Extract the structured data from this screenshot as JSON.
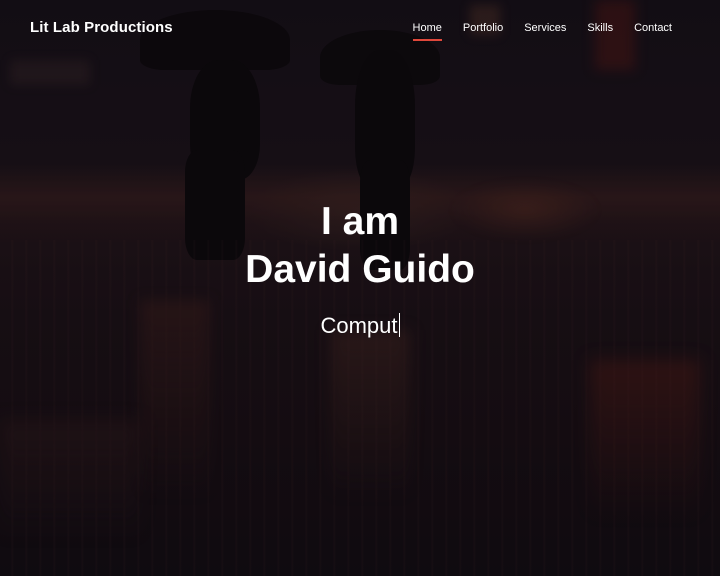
{
  "header": {
    "brand": "Lit Lab Productions",
    "nav": [
      {
        "label": "Home",
        "active": true
      },
      {
        "label": "Portfolio",
        "active": false
      },
      {
        "label": "Services",
        "active": false
      },
      {
        "label": "Skills",
        "active": false
      },
      {
        "label": "Contact",
        "active": false
      }
    ],
    "active_underline_color": "#e0483b"
  },
  "hero": {
    "line1": "I am",
    "line2": "David Guido",
    "typed_text": "Comput",
    "background_image": "night-street-people-with-umbrellas-photo"
  }
}
